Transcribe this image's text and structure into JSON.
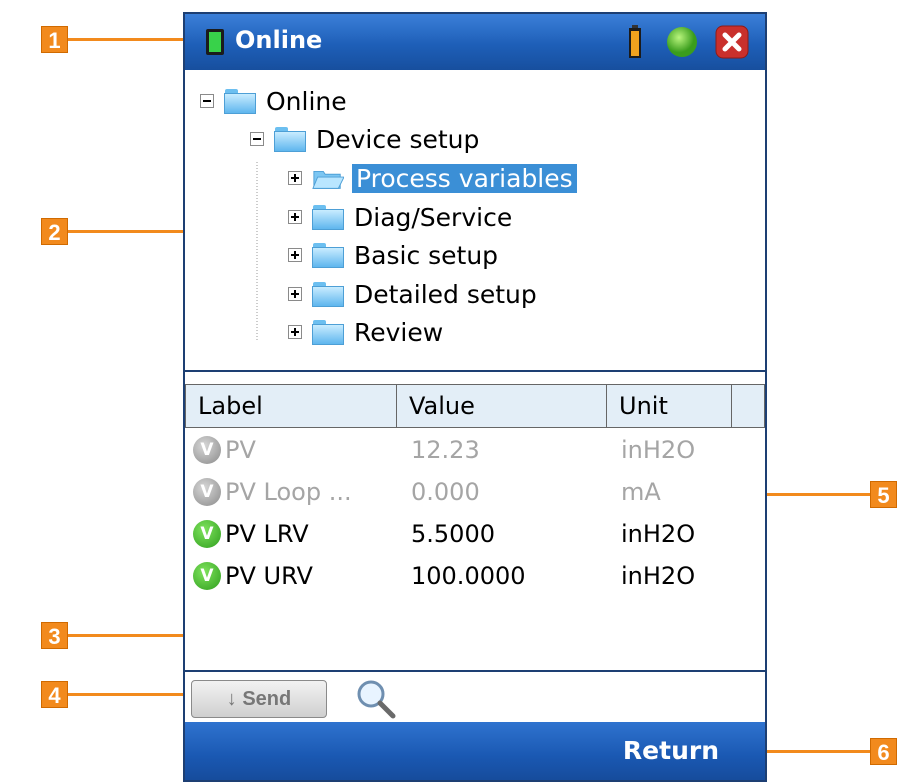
{
  "titlebar": {
    "title": "Online",
    "icons": [
      "device-status-icon",
      "battery-icon",
      "connection-status-icon",
      "close-icon"
    ]
  },
  "tree": {
    "root": "Online",
    "child": "Device setup",
    "items": [
      "Process variables",
      "Diag/Service",
      "Basic setup",
      "Detailed setup",
      "Review"
    ],
    "selected": "Process variables"
  },
  "table": {
    "headers": [
      "Label",
      "Value",
      "Unit"
    ],
    "rows": [
      {
        "badge": "V",
        "label": "PV",
        "value": "12.23",
        "unit": "inH2O",
        "state": "disabled"
      },
      {
        "badge": "V",
        "label": "PV Loop ...",
        "value": "0.000",
        "unit": "mA",
        "state": "disabled"
      },
      {
        "badge": "V",
        "label": "PV LRV",
        "value": "5.5000",
        "unit": "inH2O",
        "state": "enabled"
      },
      {
        "badge": "V",
        "label": "PV URV",
        "value": "100.0000",
        "unit": "inH2O",
        "state": "enabled"
      }
    ]
  },
  "toolbar": {
    "send_label": "Send"
  },
  "bottombar": {
    "return_label": "Return"
  },
  "callouts": [
    "1",
    "2",
    "3",
    "4",
    "5",
    "6"
  ],
  "colors": {
    "accent": "#f28a1d",
    "titlebar": "#1e5fb8",
    "selection": "#3b8fd6"
  }
}
